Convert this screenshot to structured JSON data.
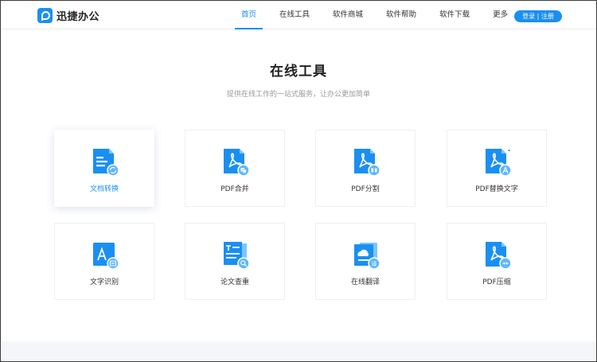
{
  "header": {
    "logo_text": "迅捷办公",
    "nav": [
      {
        "label": "首页",
        "active": true
      },
      {
        "label": "在线工具",
        "active": false
      },
      {
        "label": "软件商城",
        "active": false
      },
      {
        "label": "软件帮助",
        "active": false
      },
      {
        "label": "软件下载",
        "active": false
      },
      {
        "label": "更多",
        "active": false
      }
    ],
    "login_label": "登录 | 注册"
  },
  "main": {
    "title": "在线工具",
    "subtitle": "提供在线工作的一站式服务，让办公更加简单",
    "tools": [
      {
        "label": "文档转换",
        "icon": "document-convert-icon"
      },
      {
        "label": "PDF合并",
        "icon": "pdf-merge-icon"
      },
      {
        "label": "PDF分割",
        "icon": "pdf-split-icon"
      },
      {
        "label": "PDF替换文字",
        "icon": "pdf-replace-text-icon"
      },
      {
        "label": "文字识别",
        "icon": "text-recognition-icon"
      },
      {
        "label": "论文查重",
        "icon": "paper-check-icon"
      },
      {
        "label": "在线翻译",
        "icon": "online-translate-icon"
      },
      {
        "label": "PDF压缩",
        "icon": "pdf-compress-icon"
      }
    ]
  },
  "colors": {
    "accent": "#1a8ff2",
    "icon_light": "#7cc4ff",
    "title": "#222222",
    "subtitle": "#999999"
  }
}
